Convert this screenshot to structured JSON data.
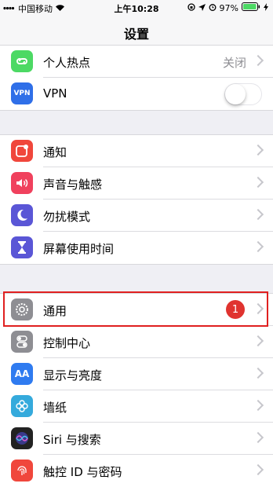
{
  "status": {
    "carrier": "中国移动",
    "time": "上午10:28",
    "battery": "97%"
  },
  "nav": {
    "title": "设置"
  },
  "group1": [
    {
      "label": "个人热点",
      "value": "关闭",
      "color": "#4cd964",
      "icon": "hotspot-icon"
    },
    {
      "label": "VPN",
      "color": "#2f6fe8",
      "icon_text": "VPN",
      "icon": "vpn-icon",
      "toggle": false
    }
  ],
  "group2": [
    {
      "label": "通知",
      "color": "#f0473c",
      "icon": "notification-icon"
    },
    {
      "label": "声音与触感",
      "color": "#f0415d",
      "icon": "sound-icon"
    },
    {
      "label": "勿扰模式",
      "color": "#5a56d6",
      "icon": "moon-icon"
    },
    {
      "label": "屏幕使用时间",
      "color": "#5a56d6",
      "icon": "hourglass-icon"
    }
  ],
  "group3": [
    {
      "label": "通用",
      "color": "#8e8e93",
      "icon": "gear-icon",
      "badge": "1"
    },
    {
      "label": "控制中心",
      "color": "#8e8e93",
      "icon": "control-center-icon"
    },
    {
      "label": "显示与亮度",
      "color": "#2f7bf0",
      "icon_text": "AA",
      "icon": "display-icon"
    },
    {
      "label": "墙纸",
      "color": "#35aadc",
      "icon": "wallpaper-icon"
    },
    {
      "label": "Siri 与搜索",
      "color": "#222222",
      "icon": "siri-icon"
    },
    {
      "label": "触控 ID 与密码",
      "color": "#f0473c",
      "icon": "touch-id-icon"
    }
  ]
}
